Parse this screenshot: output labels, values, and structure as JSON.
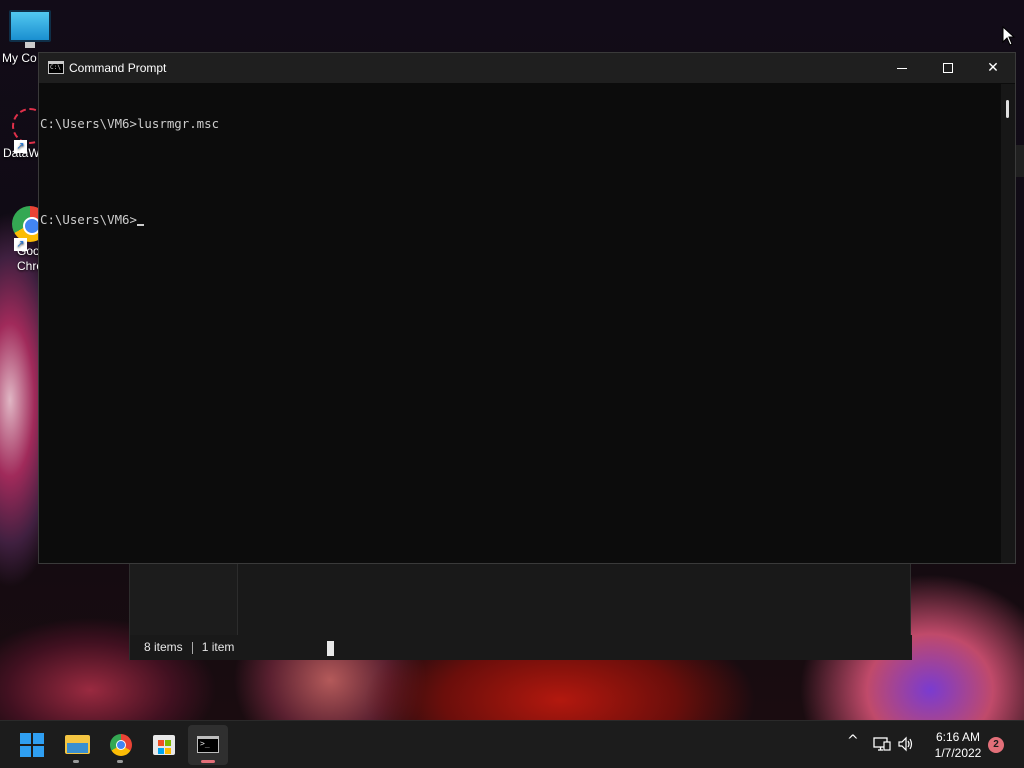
{
  "desktop": {
    "icons": [
      {
        "label": "My Co",
        "icon": "computer-monitor-icon"
      },
      {
        "label": "DataW",
        "icon": "datawrapper-icon"
      },
      {
        "label": "Goo\nChro",
        "icon": "chrome-icon"
      }
    ]
  },
  "cmd_window": {
    "title": "Command Prompt",
    "icon": "cmd-icon",
    "lines": [
      "C:\\Users\\VM6>lusrmgr.msc",
      "",
      "C:\\Users\\VM6>"
    ],
    "controls": {
      "minimize": "minimize-icon",
      "maximize": "maximize-icon",
      "close": "close-icon"
    }
  },
  "explorer_window": {
    "status_items": "8 items",
    "status_selected": "1 item"
  },
  "taskbar": {
    "apps": [
      {
        "name": "Start",
        "icon": "windows-start-icon"
      },
      {
        "name": "File Explorer",
        "icon": "folder-icon"
      },
      {
        "name": "Google Chrome",
        "icon": "chrome-icon"
      },
      {
        "name": "Microsoft Store",
        "icon": "store-icon"
      },
      {
        "name": "Command Prompt",
        "icon": "cmd-icon",
        "active": true
      }
    ],
    "tray": {
      "chevron": "^",
      "network_icon": "network-icon",
      "volume_icon": "volume-icon",
      "time": "6:16 AM",
      "date": "1/7/2022",
      "notifications": "2"
    }
  },
  "colors": {
    "accent": "#e36f79",
    "console_text": "#cccccc",
    "console_bg": "#0c0c0c",
    "titlebar_bg": "#1f1f1f",
    "taskbar_bg": "#1c1c1c"
  }
}
